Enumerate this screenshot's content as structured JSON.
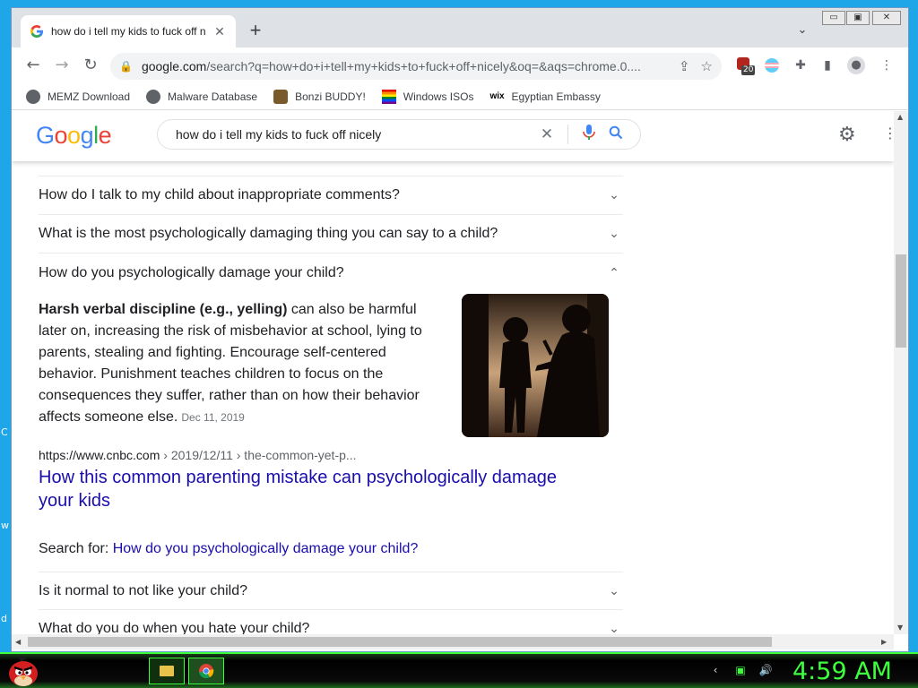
{
  "desktop": {
    "edge_glyphs": [
      "C",
      "w",
      "d"
    ]
  },
  "browser": {
    "tab": {
      "title": "how do i tell my kids to fuck off nicely - Google Search",
      "close": "✕"
    },
    "new_tab": "+",
    "tab_search": "⌄",
    "window_controls": {
      "minimize": "▭",
      "maximize": "▣",
      "close": "✕"
    },
    "nav": {
      "back": "←",
      "forward": "→",
      "reload": "↻"
    },
    "omnibox": {
      "host": "google.com",
      "path": "/search?q=how+do+i+tell+my+kids+to+fuck+off+nicely&oq=&aqs=chrome.0...."
    },
    "extensions": {
      "badge": "20"
    },
    "bookmarks": [
      {
        "label": "MEMZ Download",
        "icon": "globe-icon"
      },
      {
        "label": "Malware Database",
        "icon": "globe-icon"
      },
      {
        "label": "Bonzi BUDDY!",
        "icon": "bonzi-icon"
      },
      {
        "label": "Windows ISOs",
        "icon": "rainbow-flag-icon"
      },
      {
        "label": "Egyptian Embassy",
        "icon": "wix-icon"
      }
    ]
  },
  "google": {
    "logo": "Google",
    "query": "how do i tell my kids to fuck off nicely",
    "questions_before": [
      "How do I talk to my child about inappropriate comments?",
      "What is the most psychologically damaging thing you can say to a child?"
    ],
    "expanded": {
      "question": "How do you psychologically damage your child?",
      "answer_bold": "Harsh verbal discipline (e.g., yelling)",
      "answer_rest": " can also be harmful later on, increasing the risk of misbehavior at school, lying to parents, stealing and fighting. Encourage self-centered behavior. Punishment teaches children to focus on the consequences they suffer, rather than on how their behavior affects someone else.",
      "date": "Dec 11, 2019",
      "source_host": "https://www.cnbc.com",
      "source_path": " › 2019/12/11 › the-common-yet-p...",
      "source_title": "How this common parenting mistake can psychologically damage your kids",
      "search_for_label": "Search for: ",
      "search_for_link": "How do you psychologically damage your child?"
    },
    "questions_after": [
      "Is it normal to not like your child?",
      "What do you do when you hate your child?"
    ]
  },
  "taskbar": {
    "clock": "4:59 AM"
  },
  "colors": {
    "accent_green": "#3dff3d",
    "link_blue": "#1a0dab",
    "desktop_blue": "#1fa6e8"
  }
}
